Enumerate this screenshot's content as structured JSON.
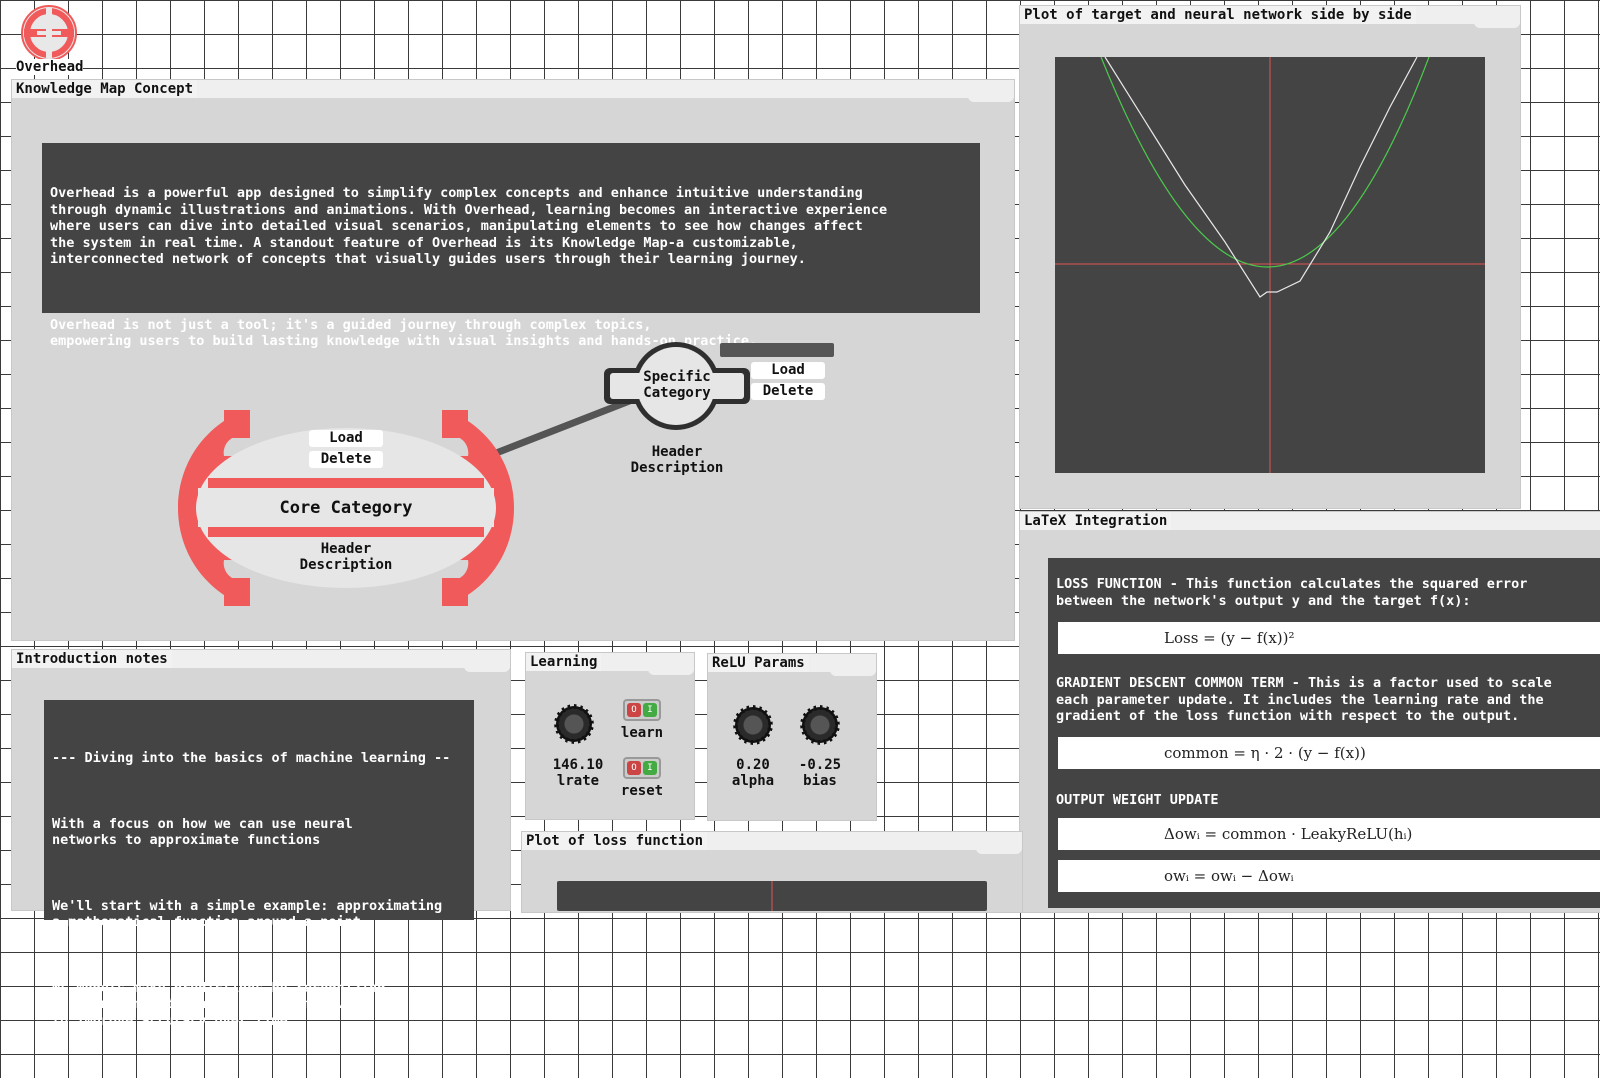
{
  "app": {
    "name": "Overhead"
  },
  "knowledge_map": {
    "title": "Knowledge Map Concept",
    "intro_para1": "Overhead is a powerful app designed to simplify complex concepts and enhance intuitive understanding\nthrough dynamic illustrations and animations. With Overhead, learning becomes an interactive experience\nwhere users can dive into detailed visual scenarios, manipulating elements to see how changes affect\nthe system in real time. A standout feature of Overhead is its Knowledge Map-a customizable,\ninterconnected network of concepts that visually guides users through their learning journey.",
    "intro_para2": "Overhead is not just a tool; it's a guided journey through complex topics,\nempowering users to build lasting knowledge with visual insights and hands-on practice.",
    "core_node": {
      "title": "Core Category",
      "description": "Header\nDescription",
      "load_label": "Load",
      "delete_label": "Delete",
      "accent": "#f05a5a"
    },
    "specific_node": {
      "title": "Specific\nCategory",
      "description": "Header\nDescription",
      "load_label": "Load",
      "delete_label": "Delete"
    }
  },
  "plot_panel": {
    "title": "Plot of target and neural network side by side",
    "target_color": "#4cc94c",
    "network_color": "#e8e8e8",
    "axis_color": "#e05555"
  },
  "latex": {
    "title": "LaTeX Integration",
    "loss_text": "LOSS FUNCTION - This function calculates the squared error\nbetween the network's output y and the target f(x):",
    "loss_formula": "Loss = (y − f(x))²",
    "gd_text": "GRADIENT DESCENT COMMON TERM - This is a factor used to scale\neach parameter update. It includes the learning rate and the\ngradient of the loss function with respect to the output.",
    "common_formula": "common = η · 2 · (y − f(x))",
    "owu_text": "OUTPUT WEIGHT UPDATE",
    "delta_formula": "Δowᵢ = common · LeakyReLU(hᵢ)",
    "ow_formula": "owᵢ = owᵢ − Δowᵢ"
  },
  "intro_notes": {
    "title": "Introduction notes",
    "line1": "--- Diving into the basics of machine learning --",
    "line2": "With a focus on how we can use neural\nnetworks to approximate functions",
    "line3": "We'll start with a simple example: approximating\na mathematical function around a point",
    "line4": "ML models make predictions by recognizing\npatterns in data, adjusting themselves\nto improve accuracy over time"
  },
  "learning": {
    "title": "Learning",
    "lrate_value": "146.10",
    "lrate_label": "lrate",
    "learn_label": "learn",
    "reset_label": "reset"
  },
  "relu": {
    "title": "ReLU Params",
    "alpha_value": "0.20",
    "alpha_label": "alpha",
    "bias_value": "-0.25",
    "bias_label": "bias"
  },
  "loss_plot": {
    "title": "Plot of loss function"
  }
}
